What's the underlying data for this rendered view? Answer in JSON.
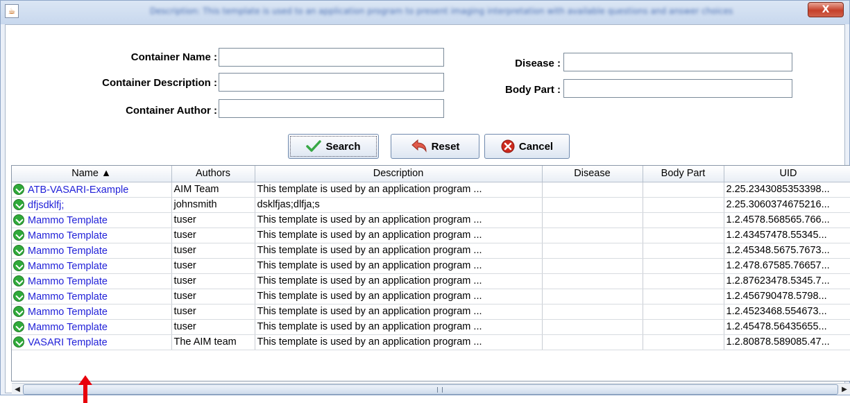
{
  "window": {
    "title": "Description: This template is used to an application program to present imaging interpretation with available questions and answer choices",
    "close_label": "X",
    "icon": "java-cup-icon"
  },
  "form": {
    "container_name": {
      "label": "Container Name :",
      "value": ""
    },
    "container_description": {
      "label": "Container Description :",
      "value": ""
    },
    "container_author": {
      "label": "Container Author :",
      "value": ""
    },
    "disease": {
      "label": "Disease :",
      "value": ""
    },
    "body_part": {
      "label": "Body Part :",
      "value": ""
    }
  },
  "buttons": {
    "search": {
      "label": "Search",
      "icon": "checkmark-icon",
      "color": "#38a845"
    },
    "reset": {
      "label": "Reset",
      "icon": "undo-arrow-icon",
      "color": "#d9534f"
    },
    "cancel": {
      "label": "Cancel",
      "icon": "cancel-circle-icon",
      "color": "#cc2a1e"
    }
  },
  "table": {
    "columns": [
      "Name ▲",
      "Authors",
      "Description",
      "Disease",
      "Body Part",
      "UID"
    ],
    "sorted_by": "Name",
    "sort_direction": "ascending",
    "row_icon": "template-check-icon",
    "rows": [
      {
        "name": "ATB-VASARI-Example",
        "authors": "AIM Team",
        "description": "This template is used by an application program ...",
        "disease": "",
        "body_part": "",
        "uid": "2.25.2343085353398..."
      },
      {
        "name": "dfjsdklfj;",
        "authors": "johnsmith",
        "description": "dsklfjas;dlfja;s",
        "disease": "",
        "body_part": "",
        "uid": "2.25.3060374675216..."
      },
      {
        "name": "Mammo Template",
        "authors": "tuser",
        "description": "This template is used by an application program ...",
        "disease": "",
        "body_part": "",
        "uid": "1.2.4578.568565.766..."
      },
      {
        "name": "Mammo Template",
        "authors": "tuser",
        "description": "This template is used by an application program ...",
        "disease": "",
        "body_part": "",
        "uid": "1.2.43457478.55345..."
      },
      {
        "name": "Mammo Template",
        "authors": "tuser",
        "description": "This template is used by an application program ...",
        "disease": "",
        "body_part": "",
        "uid": "1.2.45348.5675.7673..."
      },
      {
        "name": "Mammo Template",
        "authors": "tuser",
        "description": "This template is used by an application program ...",
        "disease": "",
        "body_part": "",
        "uid": "1.2.478.67585.76657..."
      },
      {
        "name": "Mammo Template",
        "authors": "tuser",
        "description": "This template is used by an application program ...",
        "disease": "",
        "body_part": "",
        "uid": "1.2.87623478.5345.7..."
      },
      {
        "name": "Mammo Template",
        "authors": "tuser",
        "description": "This template is used by an application program ...",
        "disease": "",
        "body_part": "",
        "uid": "1.2.456790478.5798..."
      },
      {
        "name": "Mammo Template",
        "authors": "tuser",
        "description": "This template is used by an application program ...",
        "disease": "",
        "body_part": "",
        "uid": "1.2.4523468.554673..."
      },
      {
        "name": "Mammo Template",
        "authors": "tuser",
        "description": "This template is used by an application program ...",
        "disease": "",
        "body_part": "",
        "uid": "1.2.45478.56435655..."
      },
      {
        "name": "VASARI Template",
        "authors": "The AIM team",
        "description": "This template is used by an application program ...",
        "disease": "",
        "body_part": "",
        "uid": "1.2.80878.589085.47..."
      }
    ]
  },
  "scrollbar": {
    "left_arrow": "◀",
    "right_arrow": "▶",
    "position": 0
  },
  "annotation": {
    "icon": "red-up-arrow-icon",
    "color": "#e8000b",
    "points_to": "VASARI Template"
  }
}
